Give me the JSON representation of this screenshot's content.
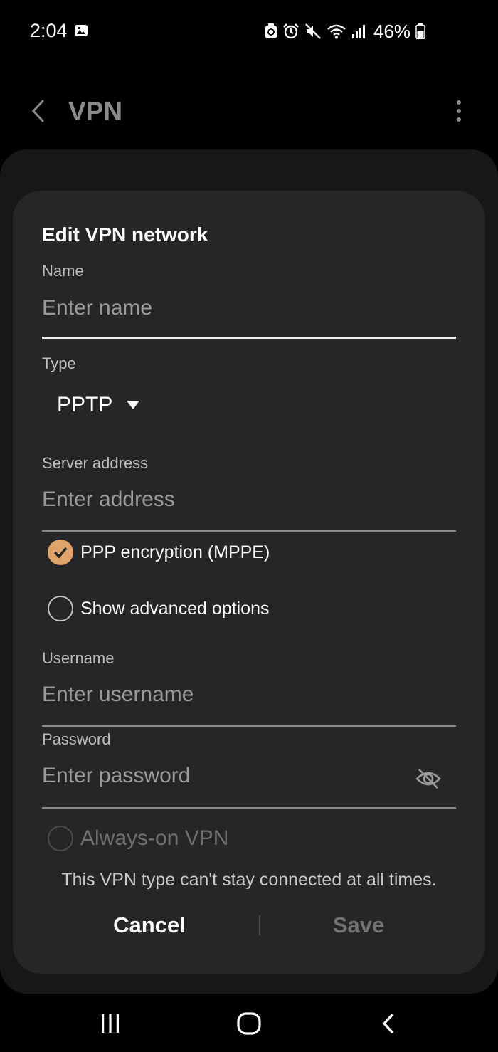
{
  "status_bar": {
    "time": "2:04",
    "battery_percent": "46%",
    "icons": [
      "gallery-icon",
      "recycle-icon",
      "alarm-icon",
      "mute-icon",
      "wifi-icon",
      "signal-icon",
      "battery-icon"
    ]
  },
  "app_bar": {
    "title": "VPN",
    "back_icon": "chevron-left-icon",
    "more_icon": "more-vert-icon"
  },
  "dialog": {
    "title": "Edit VPN network",
    "name": {
      "label": "Name",
      "placeholder": "Enter name",
      "value": ""
    },
    "type": {
      "label": "Type",
      "selected": "PPTP"
    },
    "server": {
      "label": "Server address",
      "placeholder": "Enter address",
      "value": ""
    },
    "ppp_encryption": {
      "label": "PPP encryption (MPPE)",
      "checked": true
    },
    "advanced": {
      "label": "Show advanced options",
      "checked": false
    },
    "username": {
      "label": "Username",
      "placeholder": "Enter username",
      "value": ""
    },
    "password": {
      "label": "Password",
      "placeholder": "Enter password",
      "value": "",
      "toggle_icon": "eye-off-icon"
    },
    "always_on": {
      "label": "Always-on VPN",
      "checked": false,
      "disabled": true
    },
    "note": "This VPN type can't stay connected at all times.",
    "cancel_label": "Cancel",
    "save_label": "Save"
  },
  "colors": {
    "accent": "#e0a46b",
    "dialog_bg": "#262626",
    "screen_bg": "#000000",
    "sheet_bg": "#171717",
    "disabled_text": "#727272"
  },
  "nav_bar": {
    "icons": [
      "recents-icon",
      "home-icon",
      "back-icon"
    ]
  }
}
